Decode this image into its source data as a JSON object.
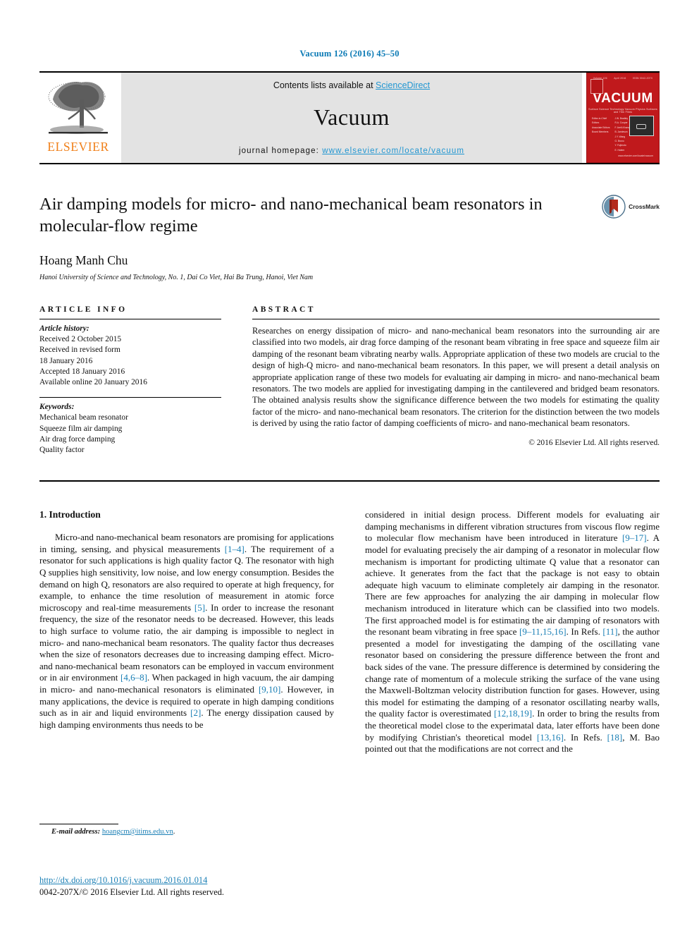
{
  "running_head": "Vacuum 126 (2016) 45–50",
  "masthead": {
    "publisher_logo_word": "ELSEVIER",
    "contents_prefix": "Contents lists available at ",
    "contents_link": "ScienceDirect",
    "journal_name": "Vacuum",
    "homepage_prefix": "journal homepage: ",
    "homepage_url": "www.elsevier.com/locate/vacuum",
    "cover": {
      "title": "VACUUM",
      "subtitle": "Surface Science Technology Vacuum Physics Surfaces and Thin Films",
      "topbar": [
        "Volume 126",
        "April 2016",
        "ISSN 0042-207X"
      ],
      "editors_left": [
        "Editor-in-Chief",
        "Editors",
        "Associate Editors",
        "Board Members"
      ],
      "editors_right": [
        "J.W. Bradley",
        "R.A. Cooper",
        "F. Arefi-Khonsari",
        "B. Jamieson",
        "J.Y. Wang",
        "G. Bruno",
        "Y. Fujimoto",
        "E. Hatem"
      ],
      "footer": "www.elsevier.com/locate/vacuum"
    }
  },
  "article": {
    "title": "Air damping models for micro- and nano-mechanical beam resonators in molecular-flow regime",
    "crossmark_label": "CrossMark",
    "author": "Hoang Manh Chu",
    "affiliation": "Hanoi University of Science and Technology, No. 1, Dai Co Viet, Hai Ba Trung, Hanoi, Viet Nam"
  },
  "article_info": {
    "heading": "ARTICLE INFO",
    "history_label": "Article history:",
    "history": [
      "Received 2 October 2015",
      "Received in revised form",
      "18 January 2016",
      "Accepted 18 January 2016",
      "Available online 20 January 2016"
    ],
    "keywords_label": "Keywords:",
    "keywords": [
      "Mechanical beam resonator",
      "Squeeze film air damping",
      "Air drag force damping",
      "Quality factor"
    ]
  },
  "abstract": {
    "heading": "ABSTRACT",
    "text": "Researches on energy dissipation of micro- and nano-mechanical beam resonators into the surrounding air are classified into two models, air drag force damping of the resonant beam vibrating in free space and squeeze film air damping of the resonant beam vibrating nearby walls. Appropriate application of these two models are crucial to the design of high-Q micro- and nano-mechanical beam resonators. In this paper, we will present a detail analysis on appropriate application range of these two models for evaluating air damping in micro- and nano-mechanical beam resonators. The two models are applied for investigating damping in the cantilevered and bridged beam resonators. The obtained analysis results show the significance difference between the two models for estimating the quality factor of the micro- and nano-mechanical beam resonators. The criterion for the distinction between the two models is derived by using the ratio factor of damping coefficients of micro- and nano-mechanical beam resonators.",
    "copyright": "© 2016 Elsevier Ltd. All rights reserved."
  },
  "introduction": {
    "section_number_title": "1. Introduction",
    "left_paragraph_parts": [
      "Micro-and nano-mechanical beam resonators are promising for applications in timing, sensing, and physical measurements ",
      "[1–4]",
      ". The requirement of a resonator for such applications is high quality factor Q. The resonator with high Q supplies high sensitivity, low noise, and low energy consumption. Besides the demand on high Q, resonators are also required to operate at high frequency, for example, to enhance the time resolution of measurement in atomic force microscopy and real-time measurements ",
      "[5]",
      ". In order to increase the resonant frequency, the size of the resonator needs to be decreased. However, this leads to high surface to volume ratio, the air damping is impossible to neglect in micro- and nano-mechanical beam resonators. The quality factor thus decreases when the size of resonators decreases due to increasing damping effect. Micro- and nano-mechanical beam resonators can be employed in vaccum environment or in air environment ",
      "[4,6–8]",
      ". When packaged in high vacuum, the air damping in micro- and nano-mechanical resonators is eliminated ",
      "[9,10]",
      ". However, in many applications, the device is required to operate in high damping conditions such as in air and liquid environments ",
      "[2]",
      ". The energy dissipation caused by high damping environments thus needs to be"
    ],
    "right_paragraph_parts": [
      "considered in initial design process. Different models for evaluating air damping mechanisms in different vibration structures from viscous flow regime to molecular flow mechanism have been introduced in literature ",
      "[9–17]",
      ". A model for evaluating precisely the air damping of a resonator in molecular flow mechanism is important for prodicting ultimate Q value that a resonator can achieve. It generates from the fact that the package is not easy to obtain adequate high vacuum to eliminate completely air damping in the resonator. There are few approaches for analyzing the air damping in molecular flow mechanism introduced in literature which can be classified into two models. The first approached model is for estimating the air damping of resonators with the resonant beam vibrating in free space ",
      "[9–11,15,16]",
      ". In Refs. ",
      "[11]",
      ", the author presented a model for investigating the damping of the oscillating vane resonator based on considering the pressure difference between the front and back sides of the vane. The pressure difference is determined by considering the change rate of momentum of a molecule striking the surface of the vane using the Maxwell-Boltzman velocity distribution function for gases. However, using this model for estimating the damping of a resonator oscillating nearby walls, the quality factor is overestimated ",
      "[12,18,19]",
      ". In order to bring the results from the theoretical model close to the experimatal data, later efforts have been done by modifying Christian's theoretical model ",
      "[13,16]",
      ". In Refs. ",
      "[18]",
      ", M. Bao pointed out that the modifications are not correct and the"
    ]
  },
  "footnote": {
    "label": "E-mail address:",
    "email": "hoangcm@itims.edu.vn",
    "trailing": "."
  },
  "page_footer": {
    "doi": "http://dx.doi.org/10.1016/j.vacuum.2016.01.014",
    "issn_line": "0042-207X/© 2016 Elsevier Ltd. All rights reserved."
  },
  "colors": {
    "link_blue": "#1a7fb5",
    "sciencedirect_blue": "#2196d1",
    "elsevier_orange": "#f0801a",
    "cover_red": "#c0191c"
  }
}
